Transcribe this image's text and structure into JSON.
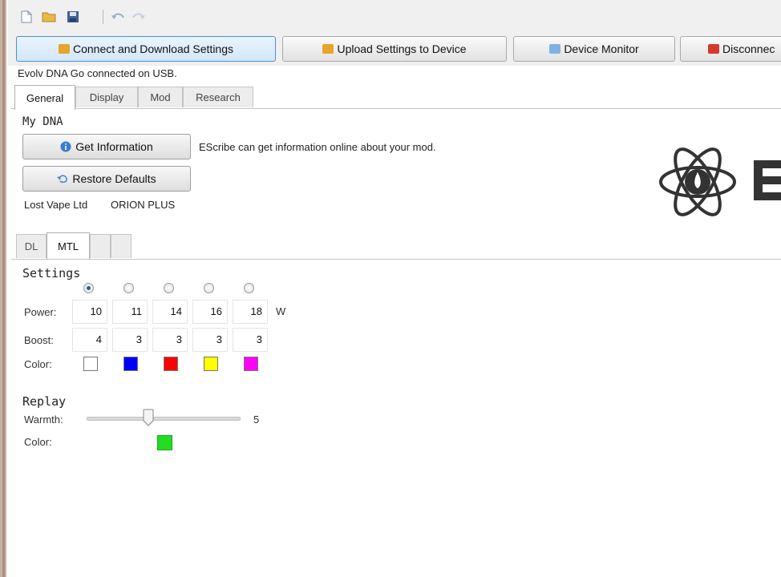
{
  "toolbar": {
    "icons": [
      "new-file-icon",
      "open-folder-icon",
      "save-icon",
      "undo-icon",
      "redo-icon"
    ]
  },
  "commands": {
    "connect_label": "Connect and Download Settings",
    "upload_label": "Upload Settings to Device",
    "monitor_label": "Device Monitor",
    "disconnect_label": "Disconnec"
  },
  "status": "Evolv DNA Go connected on USB.",
  "tabs": [
    "General",
    "Display",
    "Mod",
    "Research"
  ],
  "general": {
    "section_title": "My DNA",
    "get_info_label": "Get Information",
    "get_info_desc": "EScribe can get information online about your mod.",
    "restore_label": "Restore Defaults",
    "manufacturer": "Lost Vape Ltd",
    "product": "ORION PLUS"
  },
  "profile_tabs": [
    "DL",
    "MTL",
    "",
    ""
  ],
  "settings": {
    "title": "Settings",
    "selected_profile": 1,
    "power_label": "Power:",
    "power_values": [
      "10",
      "11",
      "14",
      "16",
      "18"
    ],
    "power_unit": "W",
    "boost_label": "Boost:",
    "boost_values": [
      "4",
      "3",
      "3",
      "3",
      "3"
    ],
    "color_label": "Color:",
    "colors": [
      "#ffffff",
      "#0000ff",
      "#ff0000",
      "#ffff00",
      "#ff00ff"
    ]
  },
  "replay": {
    "title": "Replay",
    "warmth_label": "Warmth:",
    "warmth_value": "5",
    "color_label": "Color:",
    "color": "#22dd22"
  }
}
